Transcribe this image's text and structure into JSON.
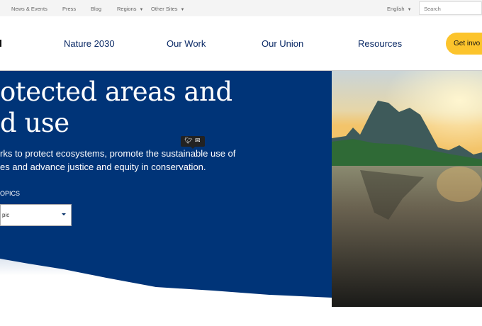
{
  "topbar": {
    "links": [
      "News & Events",
      "Press",
      "Blog",
      "Regions",
      "Other Sites"
    ],
    "language": "English",
    "search_placeholder": "Search"
  },
  "header": {
    "nav": [
      "Nature 2030",
      "Our Work",
      "Our Union",
      "Resources"
    ],
    "cta": "Get invo"
  },
  "hero": {
    "title_lines": [
      "otected areas and",
      "d use"
    ],
    "lead_lines": [
      "rks to protect ecosystems, promote the sustainable use of",
      "es and advance justice and equity in conservation."
    ],
    "topics_label": "OPICS",
    "topic_select_value": "pic",
    "share_icons": [
      "twitter-icon",
      "email-icon"
    ]
  },
  "colors": {
    "hero_blue": "#003478",
    "cta_yellow": "#fcc42c",
    "nav_text": "#0b2a66"
  }
}
